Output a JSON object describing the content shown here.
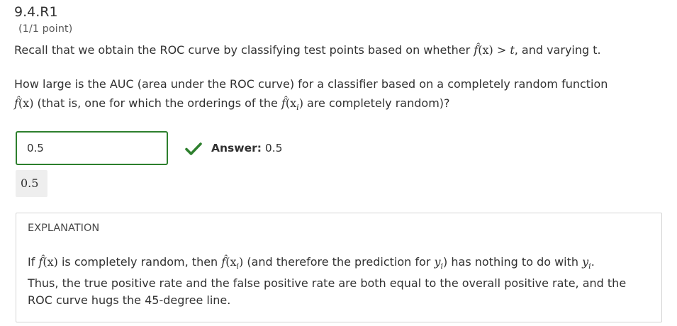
{
  "problem": {
    "title": "9.4.R1",
    "score": "(1/1 point)",
    "intro_before": "Recall that we obtain the ROC curve by classifying test points based on whether ",
    "intro_math_fhat": "f̂",
    "intro_math_x": "(x)",
    "intro_math_gt": " > ",
    "intro_math_t": "t",
    "intro_after": ", and varying t.",
    "question_line1": "How large is the AUC (area under the ROC curve) for a classifier based on a completely random function",
    "question_math_fhat": "f̂",
    "question_math_x": "(x)",
    "question_mid": " (that is, one for which the orderings of the ",
    "question_math_fhat2": "f̂",
    "question_math_xi": "(x",
    "question_math_i": "i",
    "question_math_close": ")",
    "question_end": " are completely random)?"
  },
  "response": {
    "input_value": "0.5",
    "answer_label": "Answer:",
    "answer_value": " 0.5",
    "preview_value": "0.5"
  },
  "explanation": {
    "heading": "EXPLANATION",
    "l1_a": "If ",
    "l1_fhat": "f̂",
    "l1_x": "(x)",
    "l1_b": " is completely random, then ",
    "l1_fhat2": "f̂",
    "l1_xi": "(x",
    "l1_i": "i",
    "l1_close": ")",
    "l1_c": " (and therefore the prediction for ",
    "l1_y1": "y",
    "l1_y1i": "i",
    "l1_d": ") has nothing to do with ",
    "l1_y2": "y",
    "l1_y2i": "i",
    "l1_e": ".",
    "line2": "Thus, the true positive rate and the false positive rate are both equal to the overall positive rate, and the",
    "line3": "ROC curve hugs the 45-degree line."
  },
  "colors": {
    "correct_green": "#2d7f2d",
    "text": "#313131",
    "preview_bg": "#eeeeee"
  },
  "icons": {
    "status": "checkmark-icon"
  }
}
